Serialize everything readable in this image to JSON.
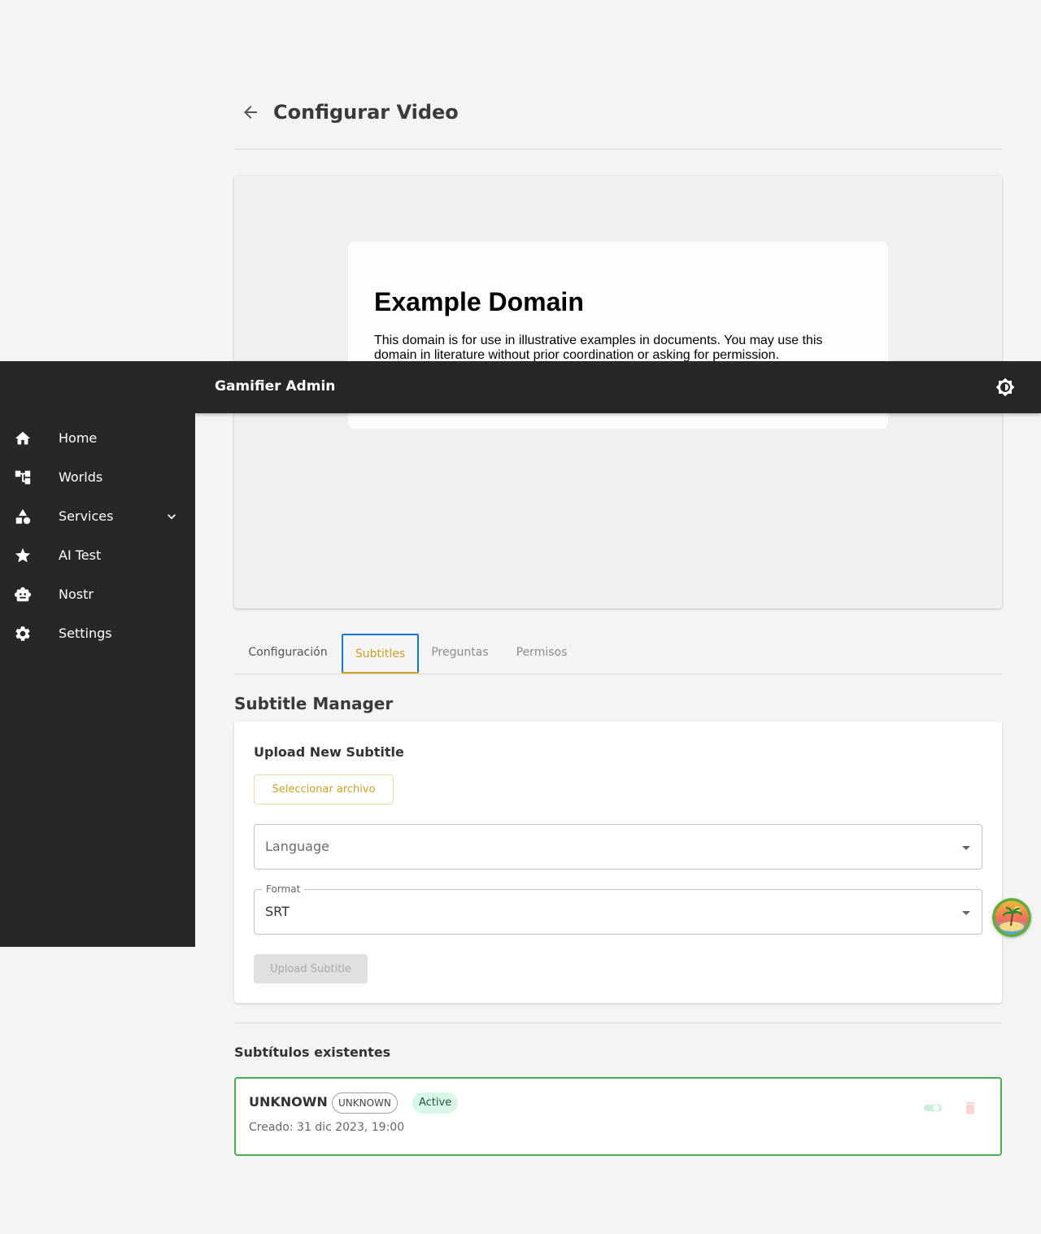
{
  "app": {
    "title": "Gamifier Admin"
  },
  "page": {
    "title": "Configurar Video"
  },
  "preview": {
    "heading": "Example Domain",
    "text": "This domain is for use in illustrative examples in documents. You may use this domain in literature without prior coordination or asking for permission."
  },
  "sidebar": {
    "items": [
      {
        "label": "Home",
        "icon": "home-icon"
      },
      {
        "label": "Worlds",
        "icon": "hierarchy-icon"
      },
      {
        "label": "Services",
        "icon": "category-shapes-icon"
      },
      {
        "label": "AI Test",
        "icon": "star-icon"
      },
      {
        "label": "Nostr",
        "icon": "robot-icon"
      },
      {
        "label": "Settings",
        "icon": "gear-icon"
      }
    ]
  },
  "tabs": [
    {
      "label": "Configuración"
    },
    {
      "label": "Subtitles",
      "active": true
    },
    {
      "label": "Preguntas"
    },
    {
      "label": "Permisos"
    }
  ],
  "subtitle_manager": {
    "title": "Subtitle Manager",
    "upload_title": "Upload New Subtitle",
    "select_file_label": "Seleccionar archivo",
    "language_placeholder": "Language",
    "format_label": "Format",
    "format_value": "SRT",
    "upload_button": "Upload Subtitle"
  },
  "existing": {
    "title": "Subtítulos existentes",
    "items": [
      {
        "name": "UNKNOWN",
        "language_chip": "UNKNOWN",
        "status": "Active",
        "created": "Creado: 31 dic 2023, 19:00"
      }
    ]
  },
  "colors": {
    "sidebar_bg": "#272727",
    "accent": "#c9a227",
    "active_border": "#4caf50",
    "focus_outline": "#1976d2"
  }
}
